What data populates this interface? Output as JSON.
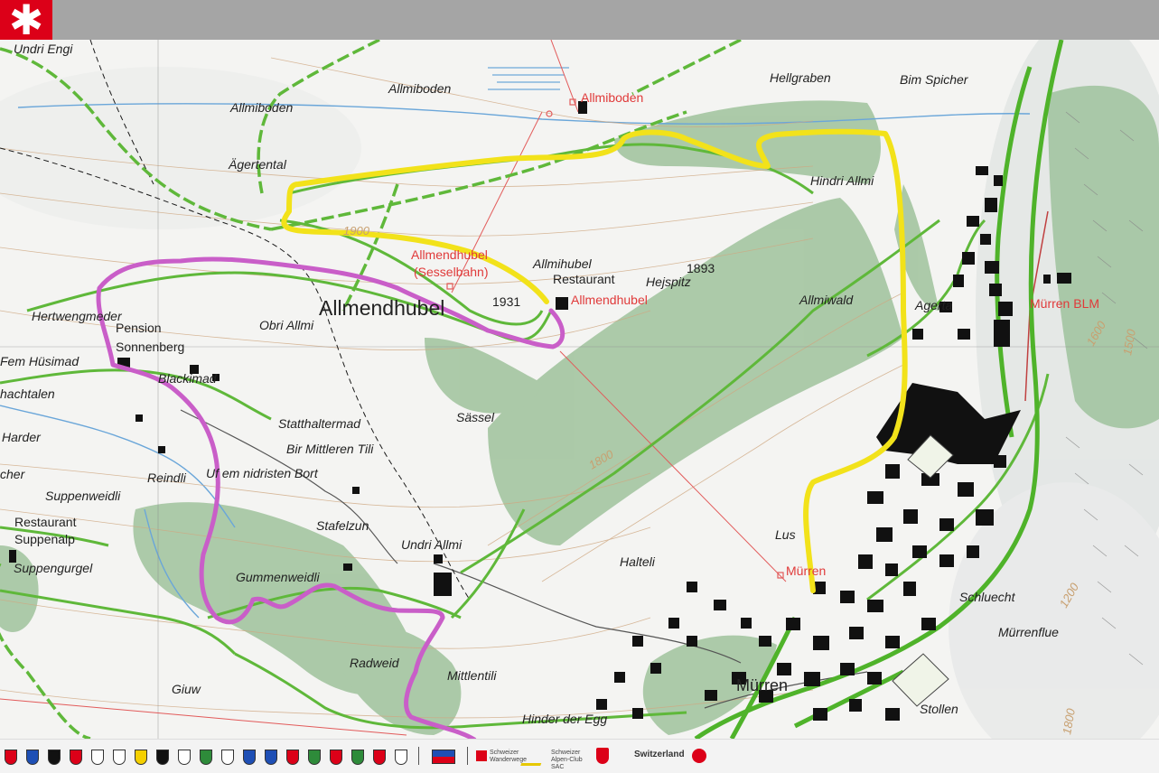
{
  "header": {
    "logo_icon": "asterisk-icon",
    "logo_glyph": "✱"
  },
  "colors": {
    "accent_red": "#dc0018",
    "route_yellow": "#f2e21a",
    "route_magenta": "#c95ec8",
    "trail_green": "#5fb83a",
    "forest_green": "#8fb58a"
  },
  "map": {
    "places": [
      "Undri Engi",
      "Allmiboden",
      "Allmiboden",
      "Hellgraben",
      "Bim Spicher",
      "Ägertental",
      "Hindri Allmi",
      "Allmihubel",
      "Hejspitz",
      "Allmiwald",
      "Agerta",
      "Hertwengmeder",
      "Obri Allmi",
      "Fem Hüsimad",
      "Blackimad",
      "hachtalen",
      "Sässel",
      "Statthaltermad",
      "Bir Mittleren Tili",
      "Harder",
      "Reindli",
      "Uf em nidristen Bort",
      "cher",
      "Suppenweidli",
      "Stafelzun",
      "Lus",
      "Undri Allmi",
      "Halteli",
      "Schluecht",
      "Suppengurgel",
      "Gummenweidli",
      "Mürrenflue",
      "Radweid",
      "Mittlentili",
      "Giuw",
      "Hinder der Egg",
      "Stollen"
    ],
    "title_label": "Allmendhubel",
    "pois": [
      "Pension",
      "Sonnenberg",
      "Restaurant",
      "Restaurant",
      "Suppenalp"
    ],
    "red_labels": [
      "Allmiboden",
      "Allmendhubel",
      "(Sesselbahn)",
      "Allmendhubel",
      "Mürren",
      "Mürren BLM"
    ],
    "town": "Mürren",
    "elevations": [
      "1893",
      "1931"
    ],
    "contours": [
      "1900",
      "1800",
      "1600",
      "1500",
      "1200",
      "1800"
    ]
  },
  "footer": {
    "crest_count": 26,
    "logos": [
      "Schweizer Wanderwege",
      "Schweizer Alpen-Club SAC",
      "Switzerland"
    ]
  }
}
